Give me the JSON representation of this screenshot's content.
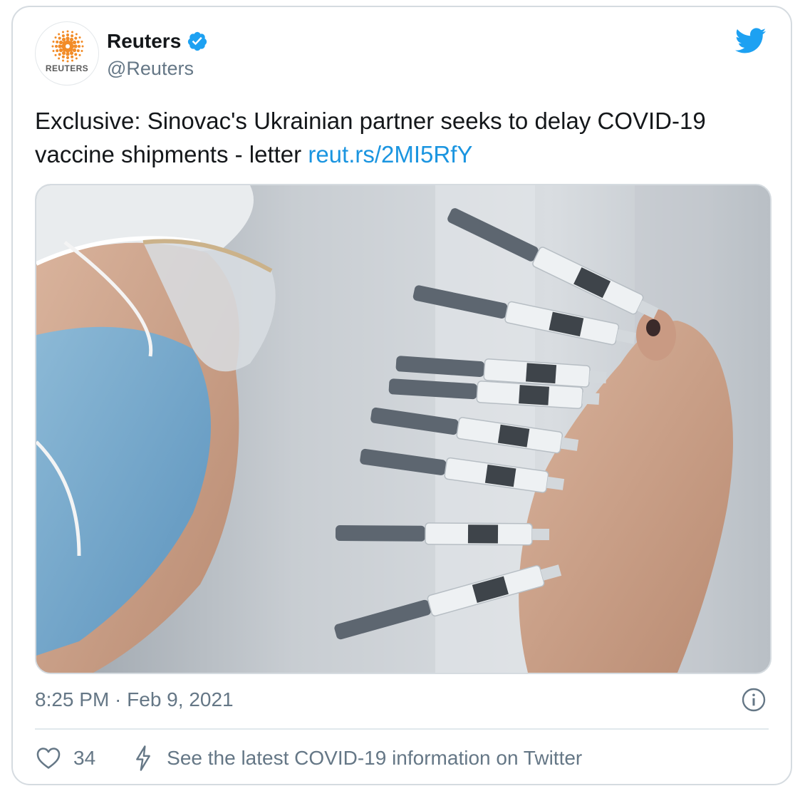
{
  "account": {
    "display_name": "Reuters",
    "handle": "@Reuters",
    "avatar_label": "REUTERS",
    "verified": true
  },
  "tweet": {
    "text": "Exclusive: Sinovac's Ukrainian partner seeks to delay COVID-19 vaccine shipments - letter ",
    "link_text": "reut.rs/2MI5RfY",
    "image_alt": "A worker holding several syringes of a COVID-19 vaccine",
    "timestamp": "8:25 PM · Feb 9, 2021"
  },
  "actions": {
    "like_count": "34",
    "covid_info_text": "See the latest COVID-19 information on Twitter"
  },
  "icons": {
    "brand": "twitter-bird-icon",
    "verified": "verified-badge-icon",
    "info": "info-icon",
    "like": "heart-icon",
    "covid": "lightning-bolt-icon"
  },
  "colors": {
    "link": "#1b95e0",
    "twitter_blue": "#1da1f2",
    "secondary_text": "#657786",
    "primary_text": "#14171a",
    "reuters_orange": "#f28c28"
  }
}
